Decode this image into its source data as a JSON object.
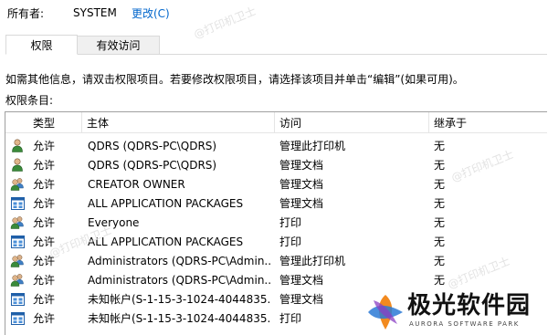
{
  "owner": {
    "label": "所有者:",
    "value": "SYSTEM",
    "change_link": "更改(C)"
  },
  "tabs": [
    {
      "label": "权限",
      "active": true
    },
    {
      "label": "有效访问",
      "active": false
    }
  ],
  "info_text": "如需其他信息，请双击权限项目。若要修改权限项目，请选择该项目并单击“编辑”(如果可用)。",
  "entries_label": "权限条目:",
  "columns": {
    "type": "类型",
    "principal": "主体",
    "access": "访问",
    "inherited_from": "继承于"
  },
  "rows": [
    {
      "icon": "user-icon",
      "type": "允许",
      "principal": "QDRS (QDRS-PC\\QDRS)",
      "access": "管理此打印机",
      "inherited_from": "无"
    },
    {
      "icon": "user-icon",
      "type": "允许",
      "principal": "QDRS (QDRS-PC\\QDRS)",
      "access": "管理文档",
      "inherited_from": "无"
    },
    {
      "icon": "group-icon",
      "type": "允许",
      "principal": "CREATOR OWNER",
      "access": "管理文档",
      "inherited_from": "无"
    },
    {
      "icon": "app-package-icon",
      "type": "允许",
      "principal": "ALL APPLICATION PACKAGES",
      "access": "管理文档",
      "inherited_from": "无"
    },
    {
      "icon": "group-icon",
      "type": "允许",
      "principal": "Everyone",
      "access": "打印",
      "inherited_from": "无"
    },
    {
      "icon": "app-package-icon",
      "type": "允许",
      "principal": "ALL APPLICATION PACKAGES",
      "access": "打印",
      "inherited_from": "无"
    },
    {
      "icon": "group-icon",
      "type": "允许",
      "principal": "Administrators (QDRS-PC\\Admin...",
      "access": "管理此打印机",
      "inherited_from": "无"
    },
    {
      "icon": "group-icon",
      "type": "允许",
      "principal": "Administrators (QDRS-PC\\Admin...",
      "access": "管理文档",
      "inherited_from": "无"
    },
    {
      "icon": "app-package-icon",
      "type": "允许",
      "principal": "未知帐户(S-1-15-3-1024-4044835...",
      "access": "管理文档",
      "inherited_from": ""
    },
    {
      "icon": "app-package-icon",
      "type": "允许",
      "principal": "未知帐户(S-1-15-3-1024-4044835...",
      "access": "打印",
      "inherited_from": ""
    }
  ],
  "watermarks": [
    "@打印机卫士",
    "@打印机卫士",
    "@打印机卫士",
    "@打印机卫士"
  ],
  "brand": {
    "name": "极光软件园",
    "subtitle": "AURORA SOFTWARE PARK"
  },
  "colors": {
    "link": "#0066cc",
    "user_green": "#3a8a3a",
    "app_blue": "#1f5fa8",
    "tab_border": "#d9d9d9"
  }
}
